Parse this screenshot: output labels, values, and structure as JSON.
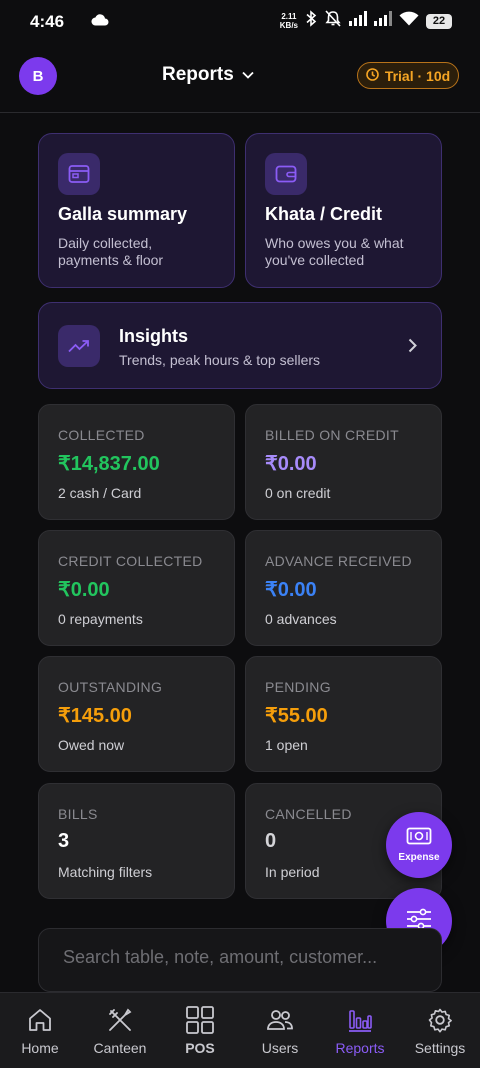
{
  "status_bar": {
    "time": "4:46",
    "net_speed_value": "2.11",
    "net_speed_unit": "KB/s",
    "battery": "22"
  },
  "header": {
    "avatar_initial": "B",
    "title": "Reports",
    "trial_badge": "Trial · 10d"
  },
  "cards": {
    "galla": {
      "title": "Galla summary",
      "desc_line1": "Daily collected,",
      "desc_line2": "payments & floor",
      "icon": "register-icon"
    },
    "khata": {
      "title": "Khata / Credit",
      "desc_line1": "Who owes you & what",
      "desc_line2": "you've collected",
      "icon": "wallet-icon"
    },
    "insights": {
      "title": "Insights",
      "desc": "Trends, peak hours & top sellers",
      "icon": "trend-up-icon"
    }
  },
  "stats": [
    {
      "label": "COLLECTED",
      "value": "₹14,837.00",
      "sub": "2 cash / Card",
      "color": "#22c55e"
    },
    {
      "label": "BILLED ON CREDIT",
      "value": "₹0.00",
      "sub": "0 on credit",
      "color": "#a78bfa"
    },
    {
      "label": "CREDIT COLLECTED",
      "value": "₹0.00",
      "sub": "0 repayments",
      "color": "#22c55e"
    },
    {
      "label": "ADVANCE RECEIVED",
      "value": "₹0.00",
      "sub": "0 advances",
      "color": "#3b82f6"
    },
    {
      "label": "OUTSTANDING",
      "value": "₹145.00",
      "sub": "Owed now",
      "color": "#f59e0b"
    },
    {
      "label": "PENDING",
      "value": "₹55.00",
      "sub": "1 open",
      "color": "#f59e0b"
    },
    {
      "label": "BILLS",
      "value": "3",
      "sub": "Matching filters",
      "color": "#ffffff"
    },
    {
      "label": "CANCELLED",
      "value": "0",
      "sub": "In period",
      "color": "#d4d4d8"
    }
  ],
  "fab": {
    "expense_label": "Expense"
  },
  "search": {
    "placeholder": "Search table, note, amount, customer..."
  },
  "nav": [
    {
      "label": "Home",
      "icon": "home-icon"
    },
    {
      "label": "Canteen",
      "icon": "fork-knife-icon"
    },
    {
      "label": "POS",
      "icon": "grid-icon"
    },
    {
      "label": "Users",
      "icon": "users-icon"
    },
    {
      "label": "Reports",
      "icon": "bar-chart-icon",
      "active": true
    },
    {
      "label": "Settings",
      "icon": "gear-icon"
    }
  ],
  "colors": {
    "accent": "#7c3aed",
    "background": "#0d0d0f",
    "trial": "#f5a524"
  }
}
